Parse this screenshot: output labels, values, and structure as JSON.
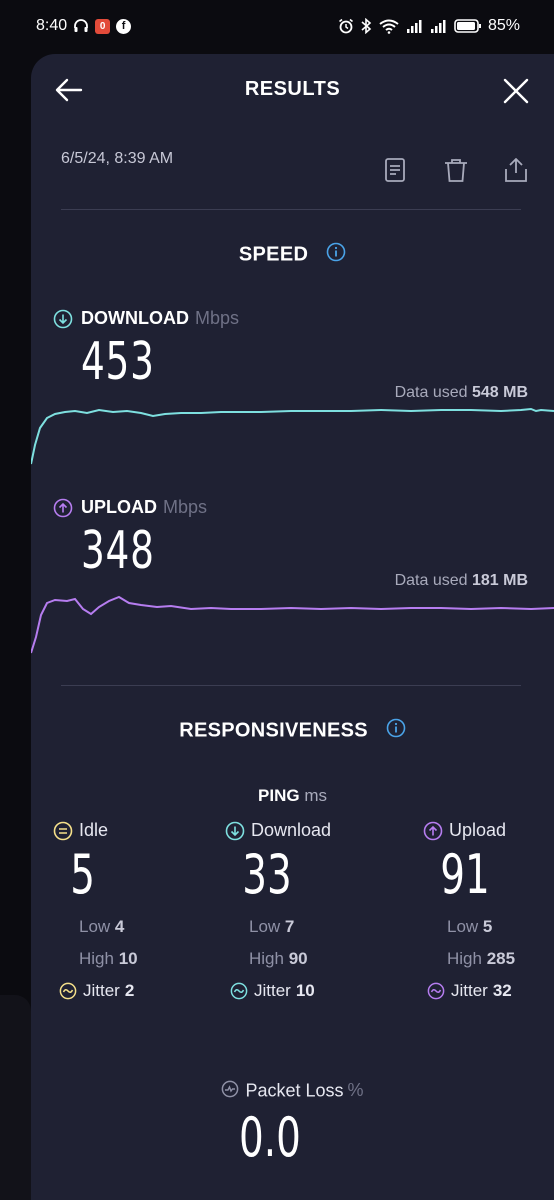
{
  "status_bar": {
    "time": "8:40",
    "battery": "85%",
    "notif_badge": "0",
    "fb_badge": "f"
  },
  "header": {
    "title": "RESULTS"
  },
  "meta": {
    "date": "6/5/24, 8:39 AM"
  },
  "speed": {
    "title": "SPEED",
    "download": {
      "label": "DOWNLOAD",
      "unit": "Mbps",
      "value": "453",
      "data_used_label": "Data used",
      "data_used": "548 MB",
      "color": "#7ee0e0"
    },
    "upload": {
      "label": "UPLOAD",
      "unit": "Mbps",
      "value": "348",
      "data_used_label": "Data used",
      "data_used": "181 MB",
      "color": "#b67df0"
    }
  },
  "responsiveness": {
    "title": "RESPONSIVENESS",
    "ping": {
      "label": "PING",
      "unit": "ms"
    },
    "columns": [
      {
        "label": "Idle",
        "value": "5",
        "low_label": "Low",
        "low": "4",
        "high_label": "High",
        "high": "10",
        "jitter_label": "Jitter",
        "jitter": "2",
        "color": "#f5e08a"
      },
      {
        "label": "Download",
        "value": "33",
        "low_label": "Low",
        "low": "7",
        "high_label": "High",
        "high": "90",
        "jitter_label": "Jitter",
        "jitter": "10",
        "color": "#7ee0e0"
      },
      {
        "label": "Upload",
        "value": "91",
        "low_label": "Low",
        "low": "5",
        "high_label": "High",
        "high": "285",
        "jitter_label": "Jitter",
        "jitter": "32",
        "color": "#b67df0"
      }
    ],
    "packet_loss": {
      "label": "Packet Loss",
      "unit": "%",
      "value": "0.0"
    }
  },
  "colors": {
    "sheet": "#1f2133",
    "accent_info": "#4aa3e8"
  }
}
